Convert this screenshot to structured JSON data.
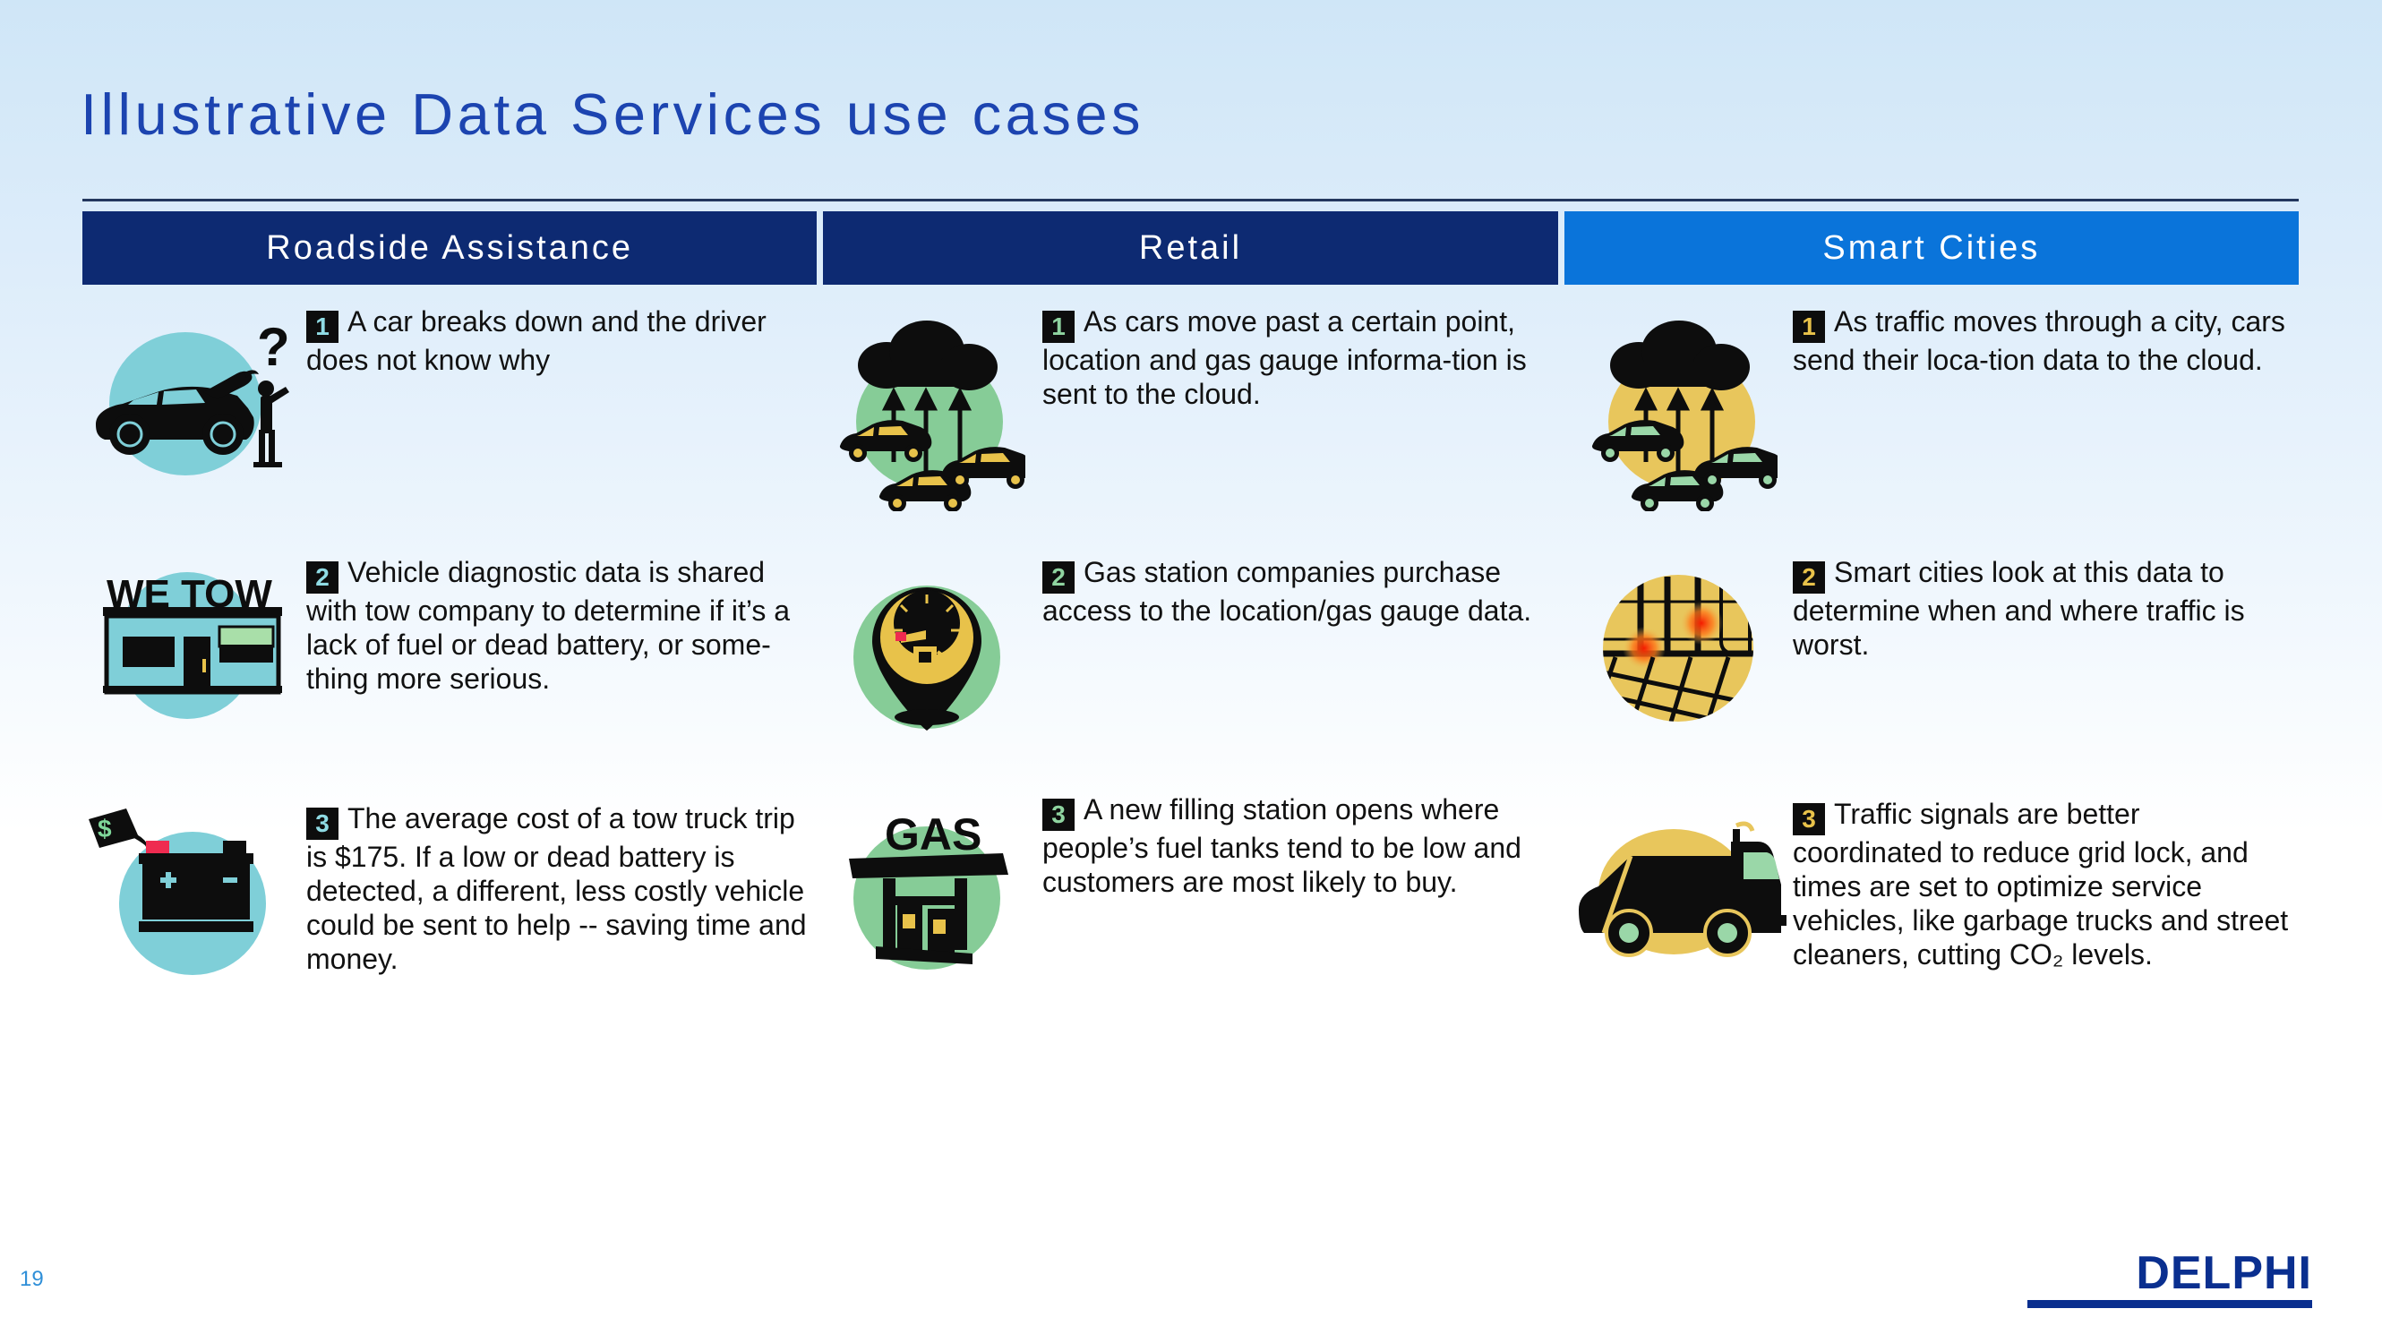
{
  "slide": {
    "title": "Illustrative Data Services use cases",
    "page_number": "19",
    "brand": "DELPHI"
  },
  "colors": {
    "header_navy": "#0d2a72",
    "header_blue": "#0a74da",
    "title_blue": "#1c44b0",
    "badge_bg": "#0d0d0d",
    "badge_teal": "#8fdbe4",
    "badge_green": "#8fd4a0",
    "badge_gold": "#e8c24a",
    "circle_teal": "#7fcfd8",
    "circle_green": "#86cc97",
    "circle_gold": "#e8c65c",
    "brand_blue": "#0a2f8f"
  },
  "columns": [
    {
      "header": "Roadside Assistance",
      "header_style": "navy",
      "badge_style": "teal",
      "items": [
        {
          "number": "1",
          "icon": "broken-down-car-icon",
          "text": "A car breaks down and the driver does not know why"
        },
        {
          "number": "2",
          "icon": "tow-shop-icon",
          "icon_label": "WE TOW",
          "text": "Vehicle diagnostic data is shared with tow company to determine if it’s a lack of fuel or dead battery, or some-thing more serious."
        },
        {
          "number": "3",
          "icon": "car-battery-price-tag-icon",
          "text": "The average cost of a tow truck trip is $175. If a low or dead battery is detected, a different, less costly vehicle could be sent to help -- saving time and money."
        }
      ]
    },
    {
      "header": "Retail",
      "header_style": "navy",
      "badge_style": "green",
      "items": [
        {
          "number": "1",
          "icon": "cars-uploading-to-cloud-icon",
          "text": "As cars move past a certain point, location and gas gauge informa-tion is sent to the cloud."
        },
        {
          "number": "2",
          "icon": "fuel-gauge-map-pin-icon",
          "text": "Gas station companies purchase access to the location/gas gauge data."
        },
        {
          "number": "3",
          "icon": "gas-station-icon",
          "icon_label": "GAS",
          "text": "A new filling station opens where people’s fuel tanks tend to be low and customers are most likely to buy."
        }
      ]
    },
    {
      "header": "Smart Cities",
      "header_style": "blue",
      "badge_style": "gold",
      "items": [
        {
          "number": "1",
          "icon": "cars-uploading-to-cloud-icon",
          "text": "As traffic moves through a city, cars send their loca-tion data to the cloud."
        },
        {
          "number": "2",
          "icon": "city-grid-heatmap-icon",
          "text": "Smart cities look at this data to determine when and where traffic is worst."
        },
        {
          "number": "3",
          "icon": "garbage-truck-icon",
          "text": "Traffic signals are better coordinated to reduce grid lock, and times are set to optimize service vehicles, like garbage trucks and street cleaners, cutting CO₂ levels."
        }
      ]
    }
  ]
}
